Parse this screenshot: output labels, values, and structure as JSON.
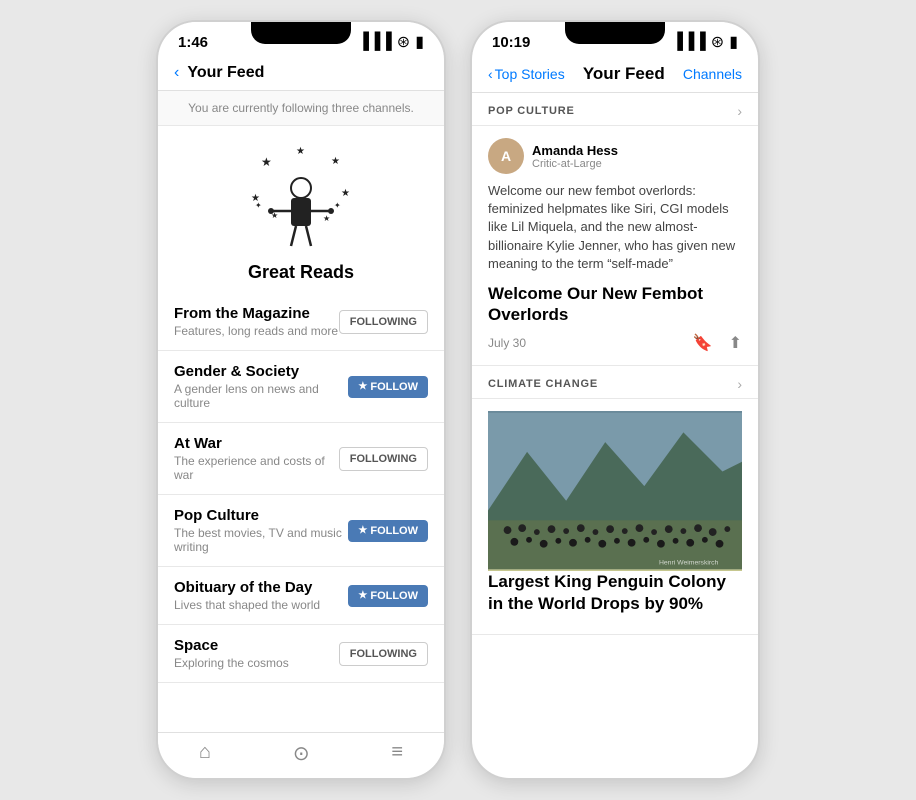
{
  "left_phone": {
    "status_time": "1:46",
    "nav": {
      "back_label": "Your Feed"
    },
    "subtitle": "You are currently following three channels.",
    "illustration_label": "Great Reads",
    "channels": [
      {
        "name": "From the Magazine",
        "desc": "Features, long reads and more",
        "state": "following",
        "btn_label": "FOLLOWING"
      },
      {
        "name": "Gender & Society",
        "desc": "A gender lens on news and culture",
        "state": "follow",
        "btn_label": "FOLLOW"
      },
      {
        "name": "At War",
        "desc": "The experience and costs of war",
        "state": "following",
        "btn_label": "FOLLOWING"
      },
      {
        "name": "Pop Culture",
        "desc": "The best movies, TV and music writing",
        "state": "follow",
        "btn_label": "FOLLOW"
      },
      {
        "name": "Obituary of the Day",
        "desc": "Lives that shaped the world",
        "state": "follow",
        "btn_label": "FOLLOW"
      },
      {
        "name": "Space",
        "desc": "Exploring the cosmos",
        "state": "following",
        "btn_label": "FOLLOWING"
      }
    ]
  },
  "right_phone": {
    "status_time": "10:19",
    "header": {
      "back_label": "Top Stories",
      "title": "Your Feed",
      "right_label": "Channels"
    },
    "sections": [
      {
        "title": "POP CULTURE",
        "author_name": "Amanda Hess",
        "author_role": "Critic-at-Large",
        "author_initial": "A",
        "preview": "Welcome our new fembot overlords: feminized helpmates like Siri, CGI models like Lil Miquela, and the new almost-billionaire Kylie Jenner, who has given new meaning to the term “self-made”",
        "headline": "Welcome Our New Fembot Overlords",
        "date": "July 30"
      },
      {
        "title": "CLIMATE CHANGE",
        "headline": "Largest King Penguin Colony in the World Drops by 90%",
        "image_credit": "Henri Weimerskirch"
      }
    ]
  }
}
